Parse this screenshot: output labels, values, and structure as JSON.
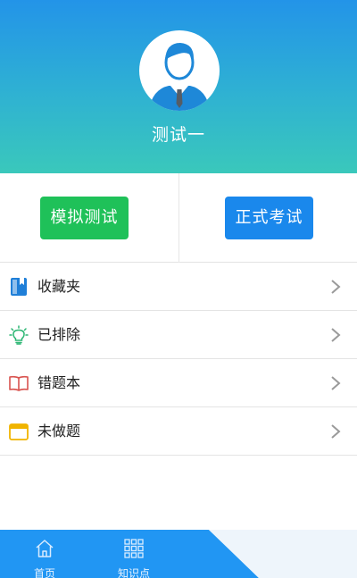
{
  "profile": {
    "username": "测试一",
    "avatar_icon": "user-avatar-icon"
  },
  "actions": {
    "mock_test_label": "模拟测试",
    "formal_exam_label": "正式考试"
  },
  "menu": {
    "items": [
      {
        "label": "收藏夹",
        "icon": "bookmark-icon",
        "icon_color": "#1f7fd8"
      },
      {
        "label": "已排除",
        "icon": "lightbulb-icon",
        "icon_color": "#2bb673"
      },
      {
        "label": "错题本",
        "icon": "open-book-icon",
        "icon_color": "#d9534f"
      },
      {
        "label": "未做题",
        "icon": "folder-icon",
        "icon_color": "#f0b400"
      }
    ]
  },
  "bottom_nav": {
    "items": [
      {
        "label": "首页",
        "icon": "home-icon"
      },
      {
        "label": "知识点",
        "icon": "grid-icon"
      }
    ]
  },
  "colors": {
    "header_top": "#2394e8",
    "header_bottom": "#3ac8bb",
    "mock_button": "#1fc159",
    "formal_button": "#1a88ec",
    "nav_blue": "#2196f3"
  }
}
